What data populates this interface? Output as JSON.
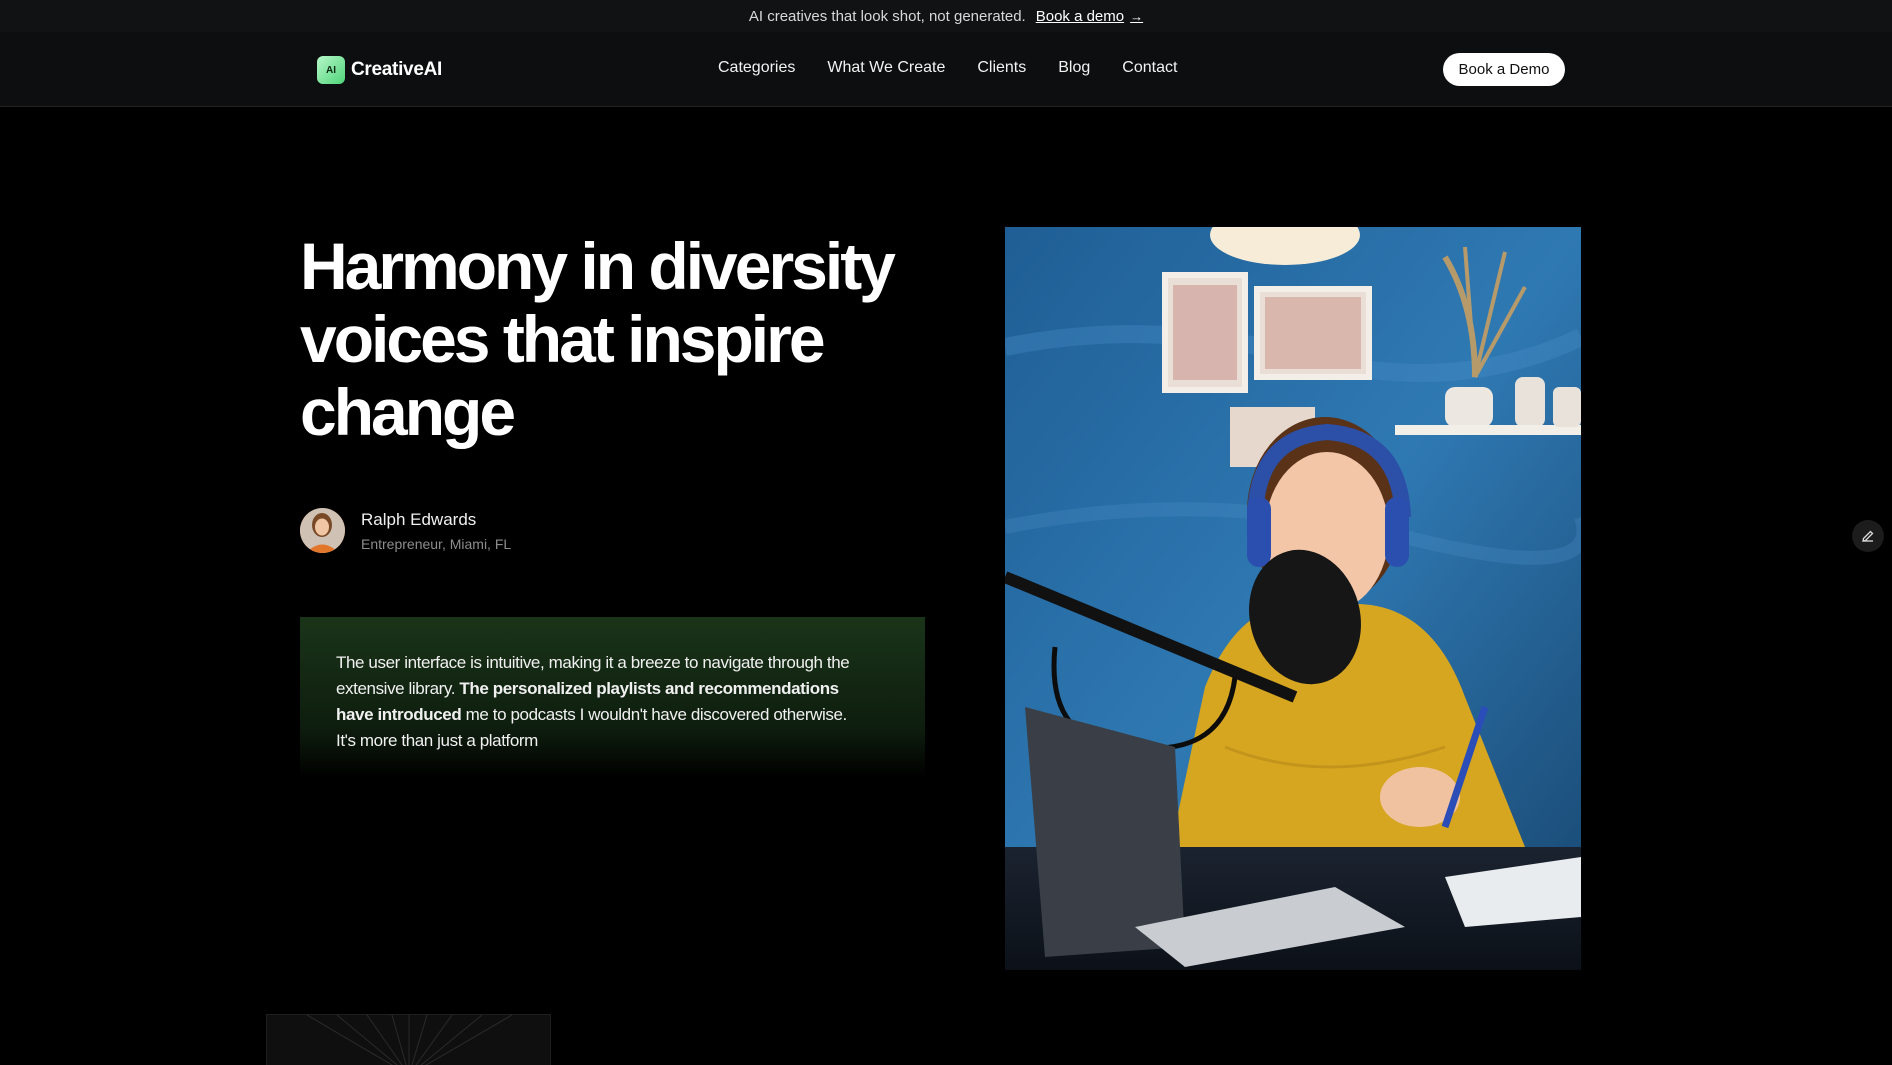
{
  "announcement": {
    "text": "AI creatives that look shot, not generated.",
    "link_label": "Book a demo",
    "link_arrow": "→"
  },
  "nav": {
    "logo_badge": "AI",
    "logo_text": "CreativeAI",
    "links": [
      "Categories",
      "What We Create",
      "Clients",
      "Blog",
      "Contact"
    ],
    "cta_label": "Book a Demo"
  },
  "hero": {
    "headline_lines": [
      "Harmony in diversity",
      "voices that inspire",
      "change"
    ]
  },
  "testimonial": {
    "author_name": "Ralph Edwards",
    "author_role": "Entrepreneur, Miami, FL",
    "quote_part1": "The user interface is intuitive, making it a breeze to navigate through the extensive library. ",
    "quote_bold": "The personalized playlists and recommendations have introduced",
    "quote_part2": " me to podcasts I wouldn't have discovered otherwise. It's more than just a platform"
  },
  "colors": {
    "background": "#000000",
    "nav_background": "#0d0e0f",
    "quote_gradient_top": "#1a3419",
    "logo_green": "#4fd479"
  }
}
